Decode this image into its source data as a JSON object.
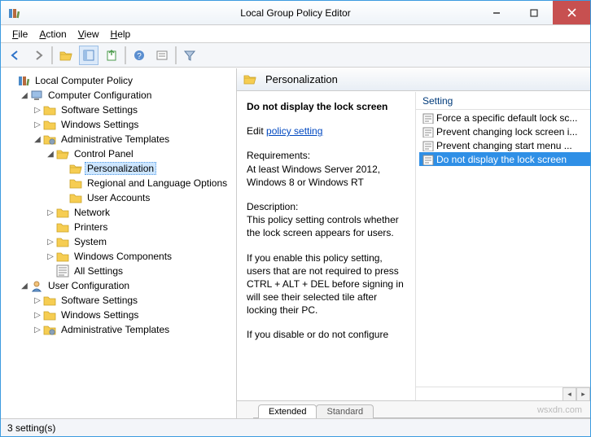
{
  "window": {
    "title": "Local Group Policy Editor"
  },
  "menus": {
    "file": "File",
    "action": "Action",
    "view": "View",
    "help": "Help"
  },
  "tree": {
    "root": "Local Computer Policy",
    "computer": "Computer Configuration",
    "cc_software": "Software Settings",
    "cc_windows": "Windows Settings",
    "cc_admin": "Administrative Templates",
    "cp": "Control Panel",
    "cp_person": "Personalization",
    "cp_regional": "Regional and Language Options",
    "cp_user": "User Accounts",
    "network": "Network",
    "printers": "Printers",
    "system": "System",
    "wincomp": "Windows Components",
    "allset": "All Settings",
    "user": "User Configuration",
    "uc_software": "Software Settings",
    "uc_windows": "Windows Settings",
    "uc_admin": "Administrative Templates"
  },
  "detail": {
    "heading": "Personalization",
    "item_title": "Do not display the lock screen",
    "edit_label": "Edit",
    "link": "policy setting",
    "req_label": "Requirements:",
    "req_text": "At least Windows Server 2012, Windows 8 or Windows RT",
    "desc_label": "Description:",
    "desc_p1": "This policy setting controls whether the lock screen appears for users.",
    "desc_p2": "If you enable this policy setting, users that are not required to press CTRL + ALT + DEL before signing in will see their selected tile after locking their PC.",
    "desc_p3": "If you disable or do not configure"
  },
  "list": {
    "header": "Setting",
    "rows": [
      "Force a specific default lock sc...",
      "Prevent changing lock screen i...",
      "Prevent changing start menu ...",
      "Do not display the lock screen"
    ],
    "selected_index": 3
  },
  "tabs": {
    "extended": "Extended",
    "standard": "Standard"
  },
  "status": "3 setting(s)",
  "watermark": "wsxdn.com"
}
